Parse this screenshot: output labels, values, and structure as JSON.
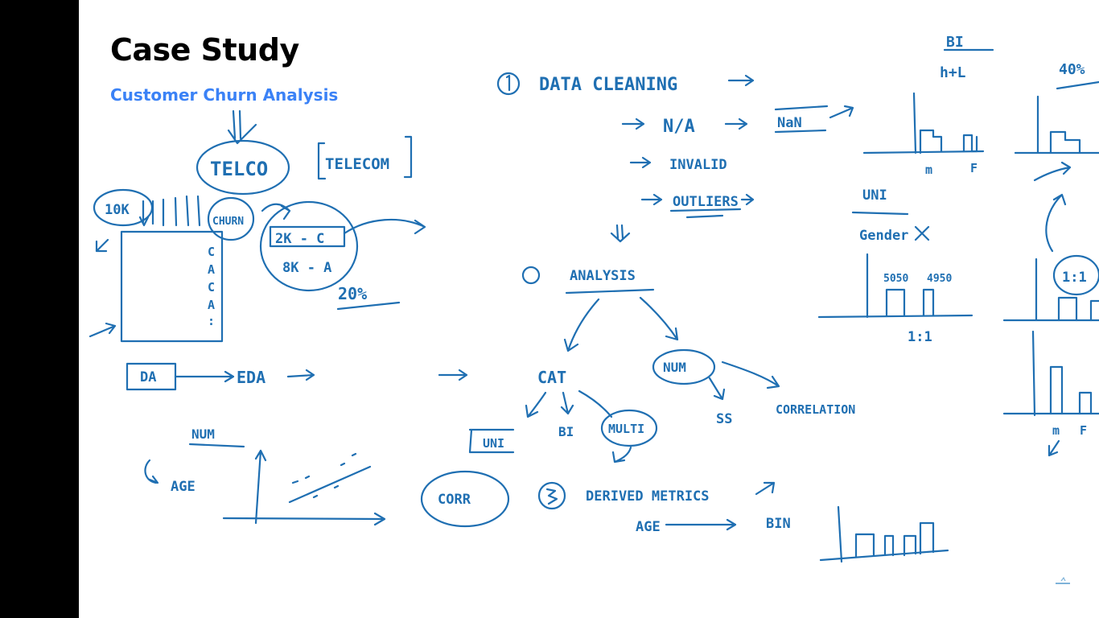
{
  "slide": {
    "title": "Case Study",
    "subtitle": "Customer Churn Analysis",
    "accent_color": "#3b82f6",
    "ink_color": "#1f6fb2",
    "sidebar_color": "#000000"
  },
  "notes": {
    "telco": "TELCO",
    "telecom": "TELECOM",
    "ten_k": "10K",
    "churn_label": "CHURN",
    "churn_col": [
      "C",
      "A",
      "C",
      "A",
      ":"
    ],
    "two_k": "2K - C",
    "eight_k": "8K - A",
    "twenty_pct": "20%",
    "da": "DA",
    "eda": "EDA",
    "num_plot_label": "NUM",
    "age": "AGE",
    "step1": "DATA CLEANING",
    "na": "N/A",
    "nan": "NaN",
    "invalid": "INVALID",
    "outliers": "OUTLIERS",
    "step2": "ANALYSIS",
    "cat": "CAT",
    "num": "NUM",
    "bi": "BI",
    "multi": "MULTI",
    "uni": "UNI",
    "ss": "SS",
    "correlation": "CORRELATION",
    "corr": "CORR",
    "step3": "DERIVED METRICS",
    "age_bin_from": "AGE",
    "age_bin_to": "BIN",
    "bi_corner": "BI",
    "ht_l": "h+L",
    "forty_pct": "40%",
    "axis_m": "m",
    "axis_f": "F",
    "uni_gender": "UNI",
    "gender": "Gender",
    "val_5050": "5050",
    "val_4950": "4950",
    "ratio": "1:1",
    "ratio_circle": "1:1",
    "axis_m2": "m",
    "axis_f2": "F"
  }
}
